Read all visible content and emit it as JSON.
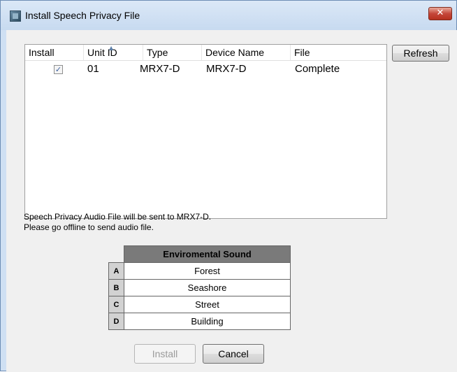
{
  "window": {
    "title": "Install Speech Privacy File",
    "close_label": "✕"
  },
  "list": {
    "columns": [
      "Install",
      "Unit ID",
      "Type",
      "Device Name",
      "File"
    ],
    "rows": [
      {
        "install": true,
        "check_glyph": "✓",
        "unit_id": "01",
        "type": "MRX7-D",
        "device_name": "MRX7-D",
        "file": "Complete"
      }
    ]
  },
  "buttons": {
    "refresh": "Refresh",
    "install": "Install",
    "cancel": "Cancel"
  },
  "message": {
    "line1": "Speech Privacy Audio File will be sent to MRX7-D.",
    "line2": "Please go offline to send audio file."
  },
  "env_table": {
    "header": "Enviromental Sound",
    "rows": [
      {
        "letter": "A",
        "value": "Forest"
      },
      {
        "letter": "B",
        "value": "Seashore"
      },
      {
        "letter": "C",
        "value": "Street"
      },
      {
        "letter": "D",
        "value": "Building"
      }
    ]
  },
  "icons": {
    "app": "speech-privacy-app-icon",
    "sort": "sort-ascending-icon"
  },
  "colors": {
    "titlebar": "#c7daf0",
    "close_button": "#c5473a",
    "table_header": "#7a7a7a"
  }
}
